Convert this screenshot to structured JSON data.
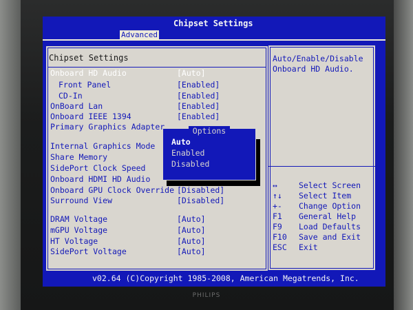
{
  "window": {
    "title": "Chipset Settings",
    "active_tab": "Advanced"
  },
  "panel": {
    "section_title": "Chipset Settings"
  },
  "settings": [
    {
      "label": "Onboard HD Audio",
      "value": "[Auto]",
      "highlight": true,
      "indent": false
    },
    {
      "label": "Front Panel",
      "value": "[Enabled]",
      "indent": true
    },
    {
      "label": "CD-In",
      "value": "[Enabled]",
      "indent": true
    },
    {
      "label": "OnBoard Lan",
      "value": "[Enabled]",
      "indent": false
    },
    {
      "label": "Onboard IEEE 1394",
      "value": "[Enabled]",
      "indent": false
    },
    {
      "label": "Primary Graphics Adapter",
      "value": "",
      "indent": false
    },
    {
      "label": "Internal Graphics Mode",
      "value": "",
      "indent": false
    },
    {
      "label": "Share Memory",
      "value": "",
      "indent": false
    },
    {
      "label": "SidePort Clock Speed",
      "value": "",
      "indent": false
    },
    {
      "label": "Onboard HDMI HD Audio",
      "value": "[Disabled]",
      "indent": false
    },
    {
      "label": "Onboard GPU Clock Override",
      "value": "[Disabled]",
      "indent": false
    },
    {
      "label": "Surround View",
      "value": "[Disabled]",
      "indent": false
    },
    {
      "label": "DRAM Voltage",
      "value": "[Auto]",
      "indent": false
    },
    {
      "label": "mGPU Voltage",
      "value": "[Auto]",
      "indent": false
    },
    {
      "label": "HT Voltage",
      "value": "[Auto]",
      "indent": false
    },
    {
      "label": "SidePort Voltage",
      "value": "[Auto]",
      "indent": false
    }
  ],
  "help": {
    "text": "Auto/Enable/Disable Onboard HD Audio."
  },
  "popup": {
    "title": "Options",
    "items": [
      "Auto",
      "Enabled",
      "Disabled"
    ],
    "selected": "Auto"
  },
  "keys": [
    {
      "key": "↔",
      "desc": "Select Screen"
    },
    {
      "key": "↑↓",
      "desc": "Select Item"
    },
    {
      "key": "+-",
      "desc": "Change Option"
    },
    {
      "key": "F1",
      "desc": "General Help"
    },
    {
      "key": "F9",
      "desc": "Load Defaults"
    },
    {
      "key": "F10",
      "desc": "Save and Exit"
    },
    {
      "key": "ESC",
      "desc": "Exit"
    }
  ],
  "footer": {
    "text": "v02.64 (C)Copyright 1985-2008, American Megatrends, Inc."
  },
  "monitor": {
    "brand": "PHILIPS"
  },
  "colors": {
    "screen_blue": "#1218b8",
    "panel_grey": "#d9d6cf",
    "highlight_white": "#ffffff"
  }
}
